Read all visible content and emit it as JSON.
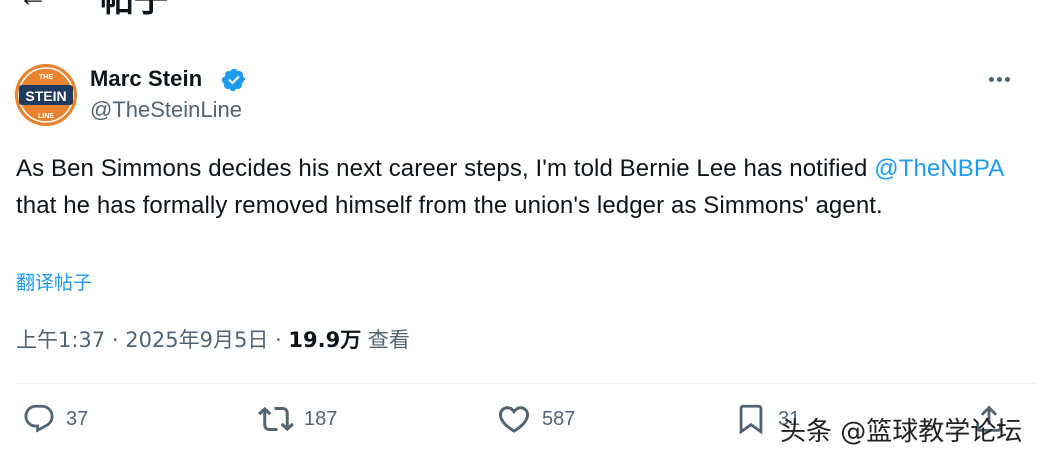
{
  "header": {
    "back_icon": "←",
    "title": "帖子"
  },
  "author": {
    "name": "Marc Stein",
    "handle": "@TheSteinLine",
    "avatar_text": "STEIN",
    "avatar_top": "THE",
    "avatar_bottom": "LINE",
    "verified": true
  },
  "tweet": {
    "text_part1": "As Ben Simmons decides his next career steps, I'm told Bernie Lee has notified ",
    "mention": "@TheNBPA",
    "text_part2": " that he has formally removed himself from the union's ledger as Simmons' agent."
  },
  "translate_label": "翻译帖子",
  "meta": {
    "time": "上午1:37",
    "separator": " · ",
    "date": "2025年9月5日",
    "separator2": " · ",
    "views_count": "19.9万",
    "views_label": " 查看"
  },
  "actions": {
    "replies": "37",
    "reposts": "187",
    "likes": "587",
    "bookmarks": "31"
  },
  "watermark": "头条 @篮球教学论坛",
  "colors": {
    "accent": "#1d9bf0",
    "secondary_text": "#536471",
    "avatar_bg": "#e8832f"
  }
}
